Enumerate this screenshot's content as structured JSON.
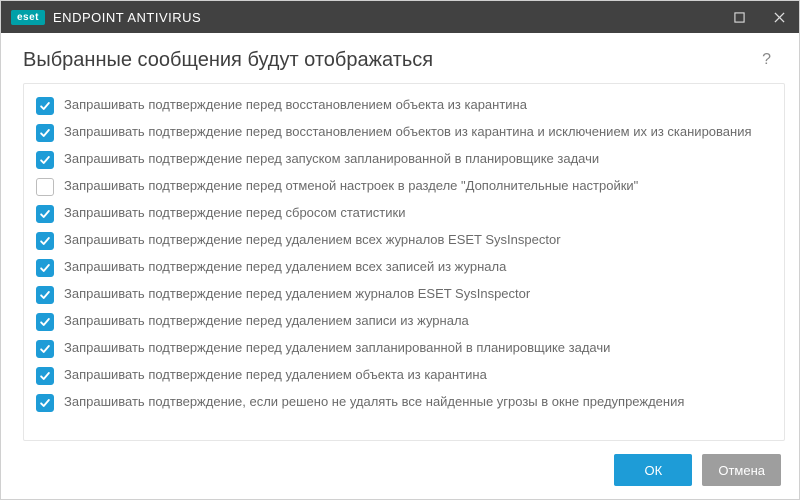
{
  "titlebar": {
    "brand": "eset",
    "product": "ENDPOINT ANTIVIRUS"
  },
  "header": {
    "title": "Выбранные сообщения будут отображаться"
  },
  "items": [
    {
      "checked": true,
      "label": "Запрашивать подтверждение перед восстановлением объекта из карантина"
    },
    {
      "checked": true,
      "label": "Запрашивать подтверждение перед восстановлением объектов из карантина и исключением их из сканирования"
    },
    {
      "checked": true,
      "label": "Запрашивать подтверждение перед запуском запланированной в планировщике задачи"
    },
    {
      "checked": false,
      "label": "Запрашивать подтверждение перед отменой настроек в разделе \"Дополнительные настройки\""
    },
    {
      "checked": true,
      "label": "Запрашивать подтверждение перед сбросом статистики"
    },
    {
      "checked": true,
      "label": "Запрашивать подтверждение перед удалением всех журналов ESET SysInspector"
    },
    {
      "checked": true,
      "label": "Запрашивать подтверждение перед удалением всех записей из журнала"
    },
    {
      "checked": true,
      "label": "Запрашивать подтверждение перед удалением журналов ESET SysInspector"
    },
    {
      "checked": true,
      "label": "Запрашивать подтверждение перед удалением записи из журнала"
    },
    {
      "checked": true,
      "label": "Запрашивать подтверждение перед удалением запланированной в планировщике задачи"
    },
    {
      "checked": true,
      "label": "Запрашивать подтверждение перед удалением объекта из карантина"
    },
    {
      "checked": true,
      "label": "Запрашивать подтверждение, если решено не удалять все найденные угрозы в окне предупреждения"
    }
  ],
  "footer": {
    "ok": "ОК",
    "cancel": "Отмена"
  }
}
